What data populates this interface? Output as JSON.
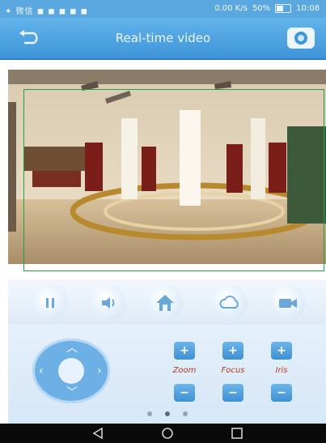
{
  "status_bar": {
    "left_text": "✦ 微信 ◼ ◼ ◼ ◼ ◼",
    "right_text": "0.00 K/s",
    "battery": "50%",
    "battery_level": 0.5,
    "time": "10:08"
  },
  "title_bar": {
    "title": "Real-time video"
  },
  "controls": {
    "pause_icon": "pause-icon",
    "audio_icon": "speaker-icon",
    "home_icon": "home-icon",
    "cloud_icon": "cloud-icon",
    "record_icon": "video-camera-icon"
  },
  "ptz": {
    "zoom_label": "Zoom",
    "focus_label": "Focus",
    "iris_label": "Iris",
    "plus": "+",
    "minus": "−"
  },
  "pagination": {
    "pages": 3,
    "active": 1
  },
  "colors": {
    "accent": "#4aa0e0",
    "header_dark": "#2f7fc0",
    "label_red": "#b23a1a"
  }
}
